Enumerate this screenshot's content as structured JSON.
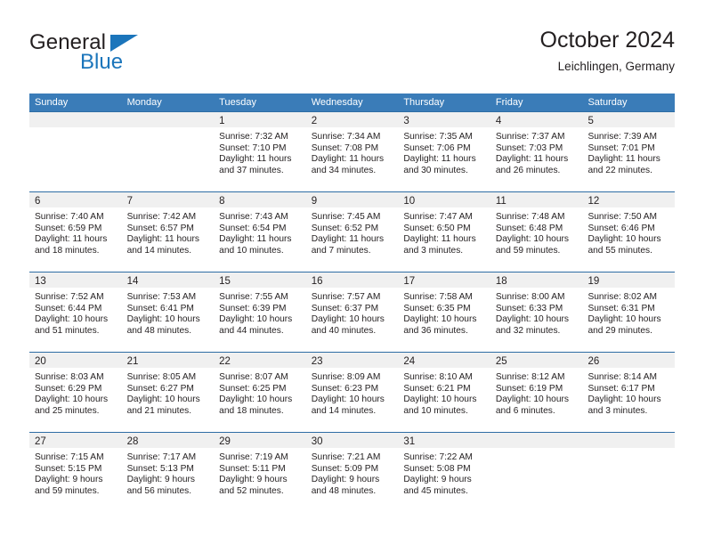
{
  "branding": {
    "logo_text_primary": "General",
    "logo_text_secondary": "Blue",
    "logo_accent_color": "#1b75bb"
  },
  "header": {
    "title": "October 2024",
    "subtitle": "Leichlingen, Germany"
  },
  "theme": {
    "header_bg": "#3a7cb8",
    "row_divider": "#2e6da4",
    "day_band_bg": "#f0f0f0",
    "text_color": "#231f20"
  },
  "weekdays": [
    "Sunday",
    "Monday",
    "Tuesday",
    "Wednesday",
    "Thursday",
    "Friday",
    "Saturday"
  ],
  "weeks": [
    [
      {
        "day": "",
        "sunrise": "",
        "sunset": "",
        "daylight_line1": "",
        "daylight_line2": ""
      },
      {
        "day": "",
        "sunrise": "",
        "sunset": "",
        "daylight_line1": "",
        "daylight_line2": ""
      },
      {
        "day": "1",
        "sunrise": "Sunrise: 7:32 AM",
        "sunset": "Sunset: 7:10 PM",
        "daylight_line1": "Daylight: 11 hours",
        "daylight_line2": "and 37 minutes."
      },
      {
        "day": "2",
        "sunrise": "Sunrise: 7:34 AM",
        "sunset": "Sunset: 7:08 PM",
        "daylight_line1": "Daylight: 11 hours",
        "daylight_line2": "and 34 minutes."
      },
      {
        "day": "3",
        "sunrise": "Sunrise: 7:35 AM",
        "sunset": "Sunset: 7:06 PM",
        "daylight_line1": "Daylight: 11 hours",
        "daylight_line2": "and 30 minutes."
      },
      {
        "day": "4",
        "sunrise": "Sunrise: 7:37 AM",
        "sunset": "Sunset: 7:03 PM",
        "daylight_line1": "Daylight: 11 hours",
        "daylight_line2": "and 26 minutes."
      },
      {
        "day": "5",
        "sunrise": "Sunrise: 7:39 AM",
        "sunset": "Sunset: 7:01 PM",
        "daylight_line1": "Daylight: 11 hours",
        "daylight_line2": "and 22 minutes."
      }
    ],
    [
      {
        "day": "6",
        "sunrise": "Sunrise: 7:40 AM",
        "sunset": "Sunset: 6:59 PM",
        "daylight_line1": "Daylight: 11 hours",
        "daylight_line2": "and 18 minutes."
      },
      {
        "day": "7",
        "sunrise": "Sunrise: 7:42 AM",
        "sunset": "Sunset: 6:57 PM",
        "daylight_line1": "Daylight: 11 hours",
        "daylight_line2": "and 14 minutes."
      },
      {
        "day": "8",
        "sunrise": "Sunrise: 7:43 AM",
        "sunset": "Sunset: 6:54 PM",
        "daylight_line1": "Daylight: 11 hours",
        "daylight_line2": "and 10 minutes."
      },
      {
        "day": "9",
        "sunrise": "Sunrise: 7:45 AM",
        "sunset": "Sunset: 6:52 PM",
        "daylight_line1": "Daylight: 11 hours",
        "daylight_line2": "and 7 minutes."
      },
      {
        "day": "10",
        "sunrise": "Sunrise: 7:47 AM",
        "sunset": "Sunset: 6:50 PM",
        "daylight_line1": "Daylight: 11 hours",
        "daylight_line2": "and 3 minutes."
      },
      {
        "day": "11",
        "sunrise": "Sunrise: 7:48 AM",
        "sunset": "Sunset: 6:48 PM",
        "daylight_line1": "Daylight: 10 hours",
        "daylight_line2": "and 59 minutes."
      },
      {
        "day": "12",
        "sunrise": "Sunrise: 7:50 AM",
        "sunset": "Sunset: 6:46 PM",
        "daylight_line1": "Daylight: 10 hours",
        "daylight_line2": "and 55 minutes."
      }
    ],
    [
      {
        "day": "13",
        "sunrise": "Sunrise: 7:52 AM",
        "sunset": "Sunset: 6:44 PM",
        "daylight_line1": "Daylight: 10 hours",
        "daylight_line2": "and 51 minutes."
      },
      {
        "day": "14",
        "sunrise": "Sunrise: 7:53 AM",
        "sunset": "Sunset: 6:41 PM",
        "daylight_line1": "Daylight: 10 hours",
        "daylight_line2": "and 48 minutes."
      },
      {
        "day": "15",
        "sunrise": "Sunrise: 7:55 AM",
        "sunset": "Sunset: 6:39 PM",
        "daylight_line1": "Daylight: 10 hours",
        "daylight_line2": "and 44 minutes."
      },
      {
        "day": "16",
        "sunrise": "Sunrise: 7:57 AM",
        "sunset": "Sunset: 6:37 PM",
        "daylight_line1": "Daylight: 10 hours",
        "daylight_line2": "and 40 minutes."
      },
      {
        "day": "17",
        "sunrise": "Sunrise: 7:58 AM",
        "sunset": "Sunset: 6:35 PM",
        "daylight_line1": "Daylight: 10 hours",
        "daylight_line2": "and 36 minutes."
      },
      {
        "day": "18",
        "sunrise": "Sunrise: 8:00 AM",
        "sunset": "Sunset: 6:33 PM",
        "daylight_line1": "Daylight: 10 hours",
        "daylight_line2": "and 32 minutes."
      },
      {
        "day": "19",
        "sunrise": "Sunrise: 8:02 AM",
        "sunset": "Sunset: 6:31 PM",
        "daylight_line1": "Daylight: 10 hours",
        "daylight_line2": "and 29 minutes."
      }
    ],
    [
      {
        "day": "20",
        "sunrise": "Sunrise: 8:03 AM",
        "sunset": "Sunset: 6:29 PM",
        "daylight_line1": "Daylight: 10 hours",
        "daylight_line2": "and 25 minutes."
      },
      {
        "day": "21",
        "sunrise": "Sunrise: 8:05 AM",
        "sunset": "Sunset: 6:27 PM",
        "daylight_line1": "Daylight: 10 hours",
        "daylight_line2": "and 21 minutes."
      },
      {
        "day": "22",
        "sunrise": "Sunrise: 8:07 AM",
        "sunset": "Sunset: 6:25 PM",
        "daylight_line1": "Daylight: 10 hours",
        "daylight_line2": "and 18 minutes."
      },
      {
        "day": "23",
        "sunrise": "Sunrise: 8:09 AM",
        "sunset": "Sunset: 6:23 PM",
        "daylight_line1": "Daylight: 10 hours",
        "daylight_line2": "and 14 minutes."
      },
      {
        "day": "24",
        "sunrise": "Sunrise: 8:10 AM",
        "sunset": "Sunset: 6:21 PM",
        "daylight_line1": "Daylight: 10 hours",
        "daylight_line2": "and 10 minutes."
      },
      {
        "day": "25",
        "sunrise": "Sunrise: 8:12 AM",
        "sunset": "Sunset: 6:19 PM",
        "daylight_line1": "Daylight: 10 hours",
        "daylight_line2": "and 6 minutes."
      },
      {
        "day": "26",
        "sunrise": "Sunrise: 8:14 AM",
        "sunset": "Sunset: 6:17 PM",
        "daylight_line1": "Daylight: 10 hours",
        "daylight_line2": "and 3 minutes."
      }
    ],
    [
      {
        "day": "27",
        "sunrise": "Sunrise: 7:15 AM",
        "sunset": "Sunset: 5:15 PM",
        "daylight_line1": "Daylight: 9 hours",
        "daylight_line2": "and 59 minutes."
      },
      {
        "day": "28",
        "sunrise": "Sunrise: 7:17 AM",
        "sunset": "Sunset: 5:13 PM",
        "daylight_line1": "Daylight: 9 hours",
        "daylight_line2": "and 56 minutes."
      },
      {
        "day": "29",
        "sunrise": "Sunrise: 7:19 AM",
        "sunset": "Sunset: 5:11 PM",
        "daylight_line1": "Daylight: 9 hours",
        "daylight_line2": "and 52 minutes."
      },
      {
        "day": "30",
        "sunrise": "Sunrise: 7:21 AM",
        "sunset": "Sunset: 5:09 PM",
        "daylight_line1": "Daylight: 9 hours",
        "daylight_line2": "and 48 minutes."
      },
      {
        "day": "31",
        "sunrise": "Sunrise: 7:22 AM",
        "sunset": "Sunset: 5:08 PM",
        "daylight_line1": "Daylight: 9 hours",
        "daylight_line2": "and 45 minutes."
      },
      {
        "day": "",
        "sunrise": "",
        "sunset": "",
        "daylight_line1": "",
        "daylight_line2": ""
      },
      {
        "day": "",
        "sunrise": "",
        "sunset": "",
        "daylight_line1": "",
        "daylight_line2": ""
      }
    ]
  ]
}
